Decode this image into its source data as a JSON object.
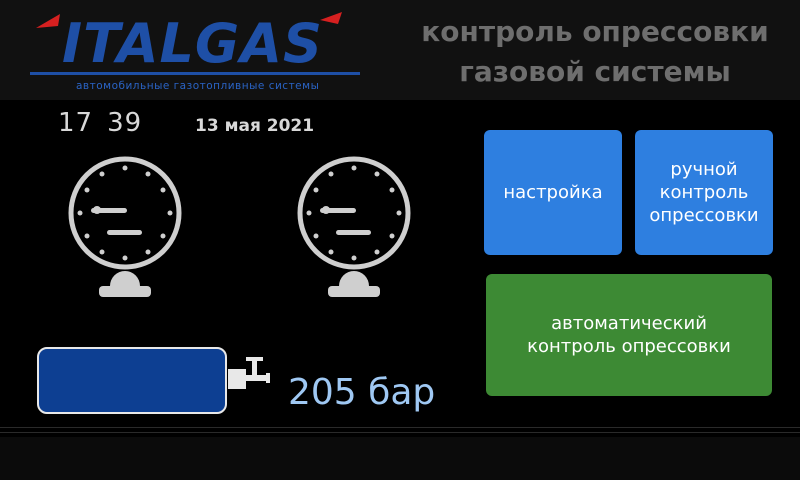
{
  "brand": {
    "logo_text": "ITALGAS",
    "logo_subtitle": "автомобильные газотопливные системы",
    "logo_red": "#d62020",
    "logo_blue": "#1e4fa6"
  },
  "header": {
    "title": "контроль опрессовки\nгазовой системы"
  },
  "clock": {
    "hours": "17",
    "minutes": "39",
    "date": "13 мая 2021"
  },
  "gauges": [
    {
      "name": "gauge-left",
      "icon": "pressure-gauge-icon"
    },
    {
      "name": "gauge-right",
      "icon": "pressure-gauge-icon"
    }
  ],
  "buttons": {
    "settings": "настройка",
    "manual": "ручной\nконтроль\nопрессовки",
    "auto": "автоматический\nконтроль опрессовки"
  },
  "tank": {
    "icon": "gas-cylinder-icon",
    "pressure": "205 бар"
  },
  "colors": {
    "button_blue": "#2e7fe0",
    "button_green": "#3d8a34",
    "tank_fill": "#0d3f92",
    "pressure_text": "#9fc8f3"
  }
}
